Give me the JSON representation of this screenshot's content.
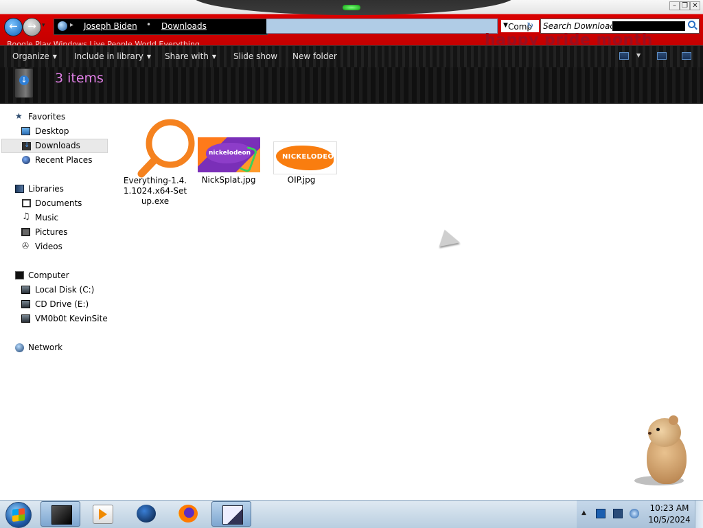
{
  "window": {
    "minimize_glyph": "–",
    "restore_glyph": "❐",
    "close_glyph": "✕"
  },
  "nav": {
    "back_glyph": "←",
    "forward_glyph": "→",
    "history_glyph": "▾"
  },
  "address": {
    "crumbs": [
      "Joseph Biden",
      "Downloads"
    ],
    "separator": "•",
    "dropdown_text": "Comp"
  },
  "search": {
    "placeholder": "Search Downloads"
  },
  "banner": {
    "text": "happy pride month"
  },
  "title_blurb": "Boogle Play  Windows Live  People  World  Everything",
  "toolbar": {
    "organize": "Organize",
    "include_in_library": "Include in library",
    "share_with": "Share with",
    "slide_show": "Slide show",
    "new_folder": "New folder",
    "caret": "▼"
  },
  "details": {
    "item_count": "3 items"
  },
  "sidebar": {
    "favorites": {
      "label": "Favorites",
      "items": [
        "Desktop",
        "Downloads",
        "Recent Places"
      ]
    },
    "libraries": {
      "label": "Libraries",
      "items": [
        "Documents",
        "Music",
        "Pictures",
        "Videos"
      ]
    },
    "computer": {
      "label": "Computer",
      "items": [
        "Local Disk (C:)",
        "CD Drive (E:)",
        "VM0b0t KevinSite"
      ]
    },
    "network": {
      "label": "Network"
    },
    "selected": "Downloads"
  },
  "files": [
    {
      "name": "Everything-1.4.1.1024.x64-Setup.exe",
      "kind": "search-app-icon"
    },
    {
      "name": "NickSplat.jpg",
      "kind": "image-thumbnail",
      "thumb_text": "nickelodeon"
    },
    {
      "name": "OIP.jpg",
      "kind": "image-thumbnail",
      "thumb_text": "NICKELODEON"
    }
  ],
  "taskbar": {
    "apps": [
      "windows-explorer",
      "media-player",
      "globe-browser",
      "firefox",
      "paint"
    ],
    "clock_time": "10:23 AM",
    "clock_date": "10/5/2024",
    "tray_arrow": "▲"
  },
  "colors": {
    "title_red": "#c40000",
    "item_count_pink": "#e07fe6",
    "everything_orange": "#f5821f"
  }
}
